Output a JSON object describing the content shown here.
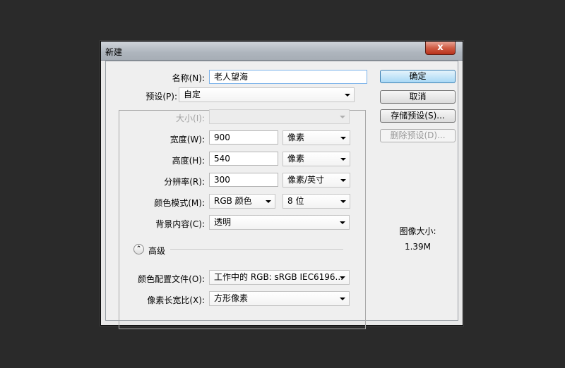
{
  "dialog": {
    "title": "新建",
    "close_label": "x"
  },
  "form": {
    "name_label": "名称(N):",
    "name_value": "老人望海",
    "preset_label": "预设(P):",
    "preset_value": "自定",
    "size_label": "大小(I):",
    "size_value": "",
    "width_label": "宽度(W):",
    "width_value": "900",
    "width_unit": "像素",
    "height_label": "高度(H):",
    "height_value": "540",
    "height_unit": "像素",
    "resolution_label": "分辨率(R):",
    "resolution_value": "300",
    "resolution_unit": "像素/英寸",
    "color_mode_label": "颜色模式(M):",
    "color_mode_value": "RGB 颜色",
    "bit_depth_value": "8 位",
    "background_label": "背景内容(C):",
    "background_value": "透明",
    "advanced_label": "高级",
    "advanced_icon": "chevron-up-double-icon",
    "color_profile_label": "颜色配置文件(O):",
    "color_profile_value": "工作中的 RGB: sRGB IEC6196...",
    "pixel_aspect_label": "像素长宽比(X):",
    "pixel_aspect_value": "方形像素"
  },
  "buttons": {
    "ok": "确定",
    "cancel": "取消",
    "save_preset": "存储预设(S)...",
    "delete_preset": "删除预设(D)..."
  },
  "image_size": {
    "label": "图像大小:",
    "value": "1.39M"
  },
  "colors": {
    "background": "#2a2a2a",
    "dialog_client": "#efefef",
    "default_button": "#a8d8f5",
    "close_button": "#cf5d45"
  }
}
